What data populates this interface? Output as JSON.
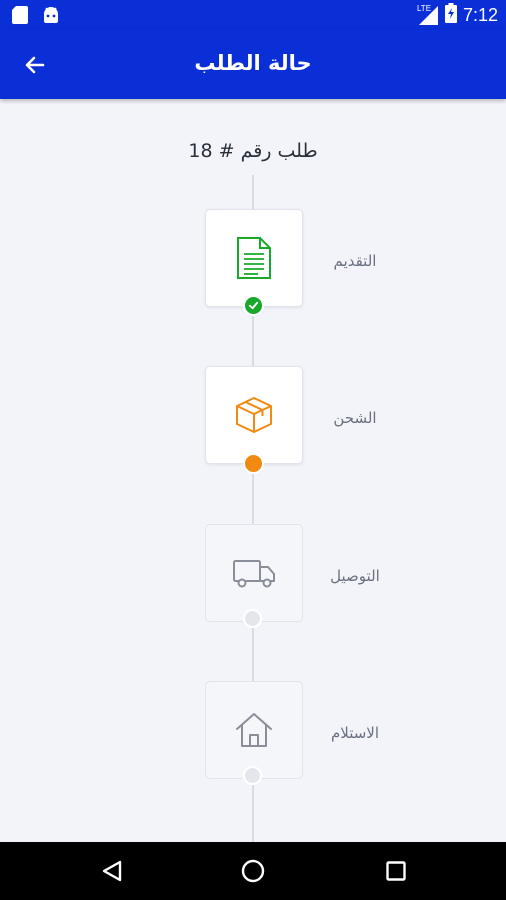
{
  "status_bar": {
    "time": "7:12",
    "network": "LTE",
    "icons": [
      "sd-card-icon",
      "android-icon",
      "signal-icon",
      "battery-charging-icon"
    ]
  },
  "app_bar": {
    "title": "حالة الطلب",
    "back_icon": "arrow-left-icon"
  },
  "order": {
    "number_label": "طلب رقم # 18"
  },
  "steps": [
    {
      "label": "التقديم",
      "icon": "document-icon",
      "status": "done"
    },
    {
      "label": "الشحن",
      "icon": "box-icon",
      "status": "active"
    },
    {
      "label": "التوصيل",
      "icon": "truck-icon",
      "status": "pending"
    },
    {
      "label": "الاستلام",
      "icon": "home-icon",
      "status": "pending"
    }
  ],
  "colors": {
    "primary": "#0a2fd6",
    "done": "#1aa82a",
    "active": "#f18a10",
    "pending": "#e4e6eb",
    "inactive_icon": "#8a8e99"
  },
  "nav_bar": {
    "buttons": [
      "back-triangle-icon",
      "home-circle-icon",
      "recents-square-icon"
    ]
  }
}
